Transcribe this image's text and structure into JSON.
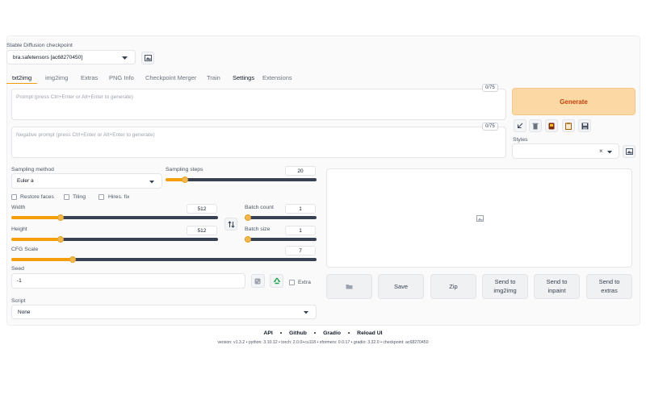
{
  "checkpoint": {
    "label": "Stable Diffusion checkpoint",
    "value": "bra.safetensors [ac68270450]"
  },
  "tabs": [
    {
      "label": "txt2img"
    },
    {
      "label": "img2img"
    },
    {
      "label": "Extras"
    },
    {
      "label": "PNG Info"
    },
    {
      "label": "Checkpoint Merger"
    },
    {
      "label": "Train"
    },
    {
      "label": "Settings"
    },
    {
      "label": "Extensions"
    }
  ],
  "prompt": {
    "placeholder": "Prompt (press Ctrl+Enter or Alt+Enter to generate)",
    "counter": "0/75"
  },
  "negative_prompt": {
    "placeholder": "Negative prompt (press Ctrl+Enter or Alt+Enter to generate)",
    "counter": "0/75"
  },
  "generate_label": "Generate",
  "styles_label": "Styles",
  "sampling": {
    "method_label": "Sampling method",
    "method_value": "Euler a",
    "steps_label": "Sampling steps",
    "steps_value": "20",
    "steps_fraction": 0.13
  },
  "options": {
    "restore_faces": "Restore faces",
    "tiling": "Tiling",
    "hires_fix": "Hires. fix"
  },
  "width": {
    "label": "Width",
    "value": "512",
    "fraction": 0.24
  },
  "height": {
    "label": "Height",
    "value": "512",
    "fraction": 0.24
  },
  "batch_count": {
    "label": "Batch count",
    "value": "1",
    "fraction": 0.0
  },
  "batch_size": {
    "label": "Batch size",
    "value": "1",
    "fraction": 0.0
  },
  "cfg": {
    "label": "CFG Scale",
    "value": "7",
    "fraction": 0.2
  },
  "seed": {
    "label": "Seed",
    "value": "-1",
    "extra_label": "Extra"
  },
  "script": {
    "label": "Script",
    "value": "None"
  },
  "output_buttons": {
    "save": "Save",
    "zip": "Zip",
    "send_img2img": "Send to img2img",
    "send_inpaint": "Send to inpaint",
    "send_extras": "Send to extras"
  },
  "footer": {
    "links": [
      "API",
      "Github",
      "Gradio",
      "Reload UI"
    ],
    "separator": "•",
    "version_line": "version: v1.3.2  •  python: 3.10.12  •  torch: 2.0.0+cu118  •  xformers: 0.0.17  •  gradio: 3.32.0  •  checkpoint: ac68270450"
  },
  "colors": {
    "accent": "#f59e0b",
    "generate_bg": "#fcd9a4",
    "generate_text": "#c2410c"
  }
}
